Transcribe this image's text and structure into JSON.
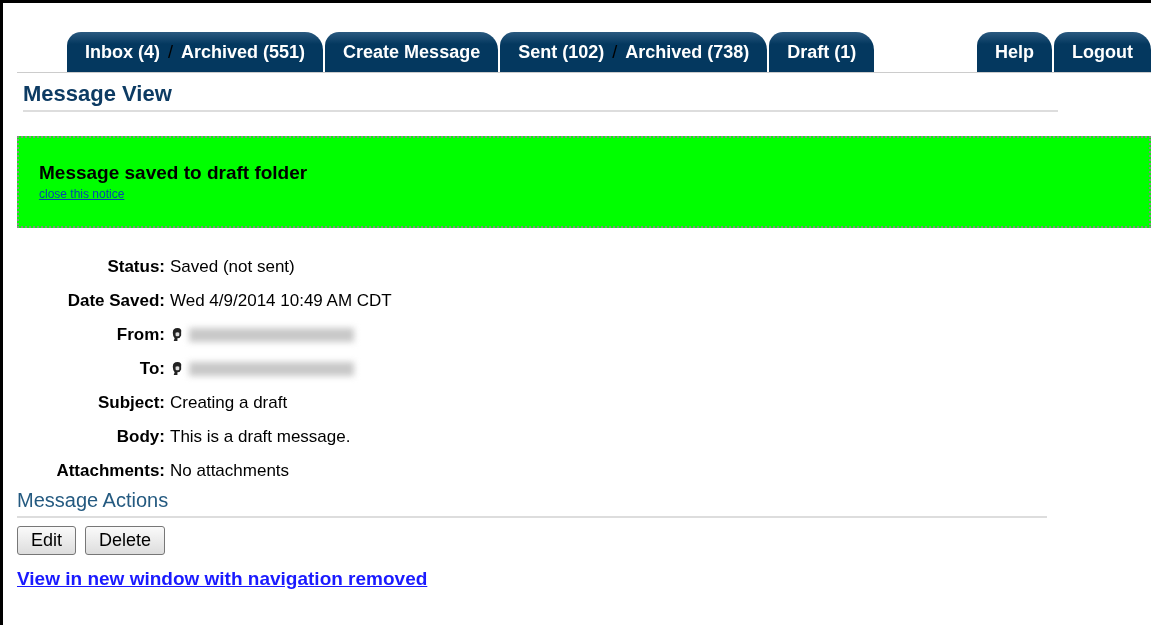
{
  "tabs_left": [
    {
      "links": [
        "Inbox (4)",
        "Archived (551)"
      ],
      "separator": "/"
    },
    {
      "links": [
        "Create Message"
      ]
    },
    {
      "links": [
        "Sent (102)",
        "Archived (738)"
      ],
      "separator": "/"
    },
    {
      "links": [
        "Draft (1)"
      ]
    }
  ],
  "tabs_right": [
    "Help",
    "Logout"
  ],
  "heading": "Message View",
  "notice": {
    "message": "Message saved to draft folder",
    "close_link": "close this notice"
  },
  "fields": [
    {
      "label": "Status:",
      "kind": "text",
      "value": "Saved (not sent)"
    },
    {
      "label": "Date Saved:",
      "kind": "text",
      "value": "Wed 4/9/2014 10:49 AM CDT"
    },
    {
      "label": "From:",
      "kind": "person"
    },
    {
      "label": "To:",
      "kind": "person"
    },
    {
      "label": "Subject:",
      "kind": "text",
      "value": "Creating a draft"
    },
    {
      "label": "Body:",
      "kind": "text",
      "value": "This is a draft message."
    },
    {
      "label": "Attachments:",
      "kind": "text",
      "value": "No attachments"
    }
  ],
  "actions_heading": "Message Actions",
  "buttons": [
    "Edit",
    "Delete"
  ],
  "footer_link": "View in new window with navigation removed"
}
